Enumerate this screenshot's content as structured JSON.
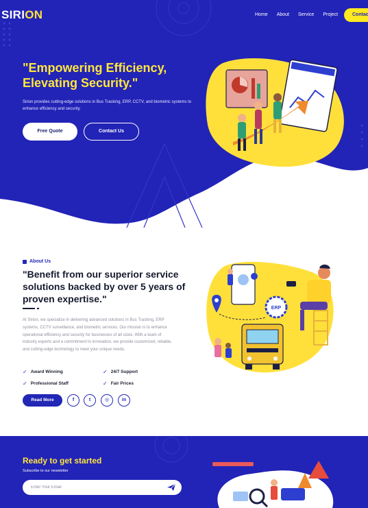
{
  "brand": {
    "part1": "SIRI",
    "part2": "ON"
  },
  "nav": {
    "items": [
      {
        "label": "Home"
      },
      {
        "label": "About"
      },
      {
        "label": "Service"
      },
      {
        "label": "Project"
      }
    ],
    "contact_label": "Contact"
  },
  "hero": {
    "title": "\"Empowering Efficiency, Elevating Security.\"",
    "description": "Sirion provides cutting-edge solutions in Bus Tracking, ERP, CCTV, and biometric systems to enhance efficiency and security.",
    "btn_primary": "Free Quote",
    "btn_secondary": "Contact Us"
  },
  "about": {
    "tag": "About Us",
    "title": "\"Benefit from our superior service solutions backed by over 5 years of proven expertise.\"",
    "description": "At Sirion, we specialize in delivering advanced solutions in Bus Tracking, ERP systems, CCTV surveillance, and biometric services. Our mission is to enhance operational efficiency and security for businesses of all sizes. With a team of industry experts and a commitment to innovation, we provide customized, reliable, and cutting-edge technology to meet your unique needs.",
    "features": [
      {
        "label": "Award Winning"
      },
      {
        "label": "24/7 Support"
      },
      {
        "label": "Professional Staff"
      },
      {
        "label": "Fair Prices"
      }
    ],
    "read_more": "Read More",
    "social": [
      {
        "icon": "facebook-icon",
        "glyph": "f"
      },
      {
        "icon": "twitter-icon",
        "glyph": "t"
      },
      {
        "icon": "instagram-icon",
        "glyph": "◎"
      },
      {
        "icon": "linkedin-icon",
        "glyph": "in"
      }
    ],
    "illustration_label": "ERP"
  },
  "newsletter": {
    "title": "Ready to get started",
    "subtitle": "Subscribe to our newsletter",
    "placeholder": "Enter Your Email"
  },
  "colors": {
    "primary": "#2223b7",
    "accent": "#ffe63d",
    "button_yellow": "#ffe91f",
    "text_dark": "#161a2e",
    "text_muted": "#8e909c"
  }
}
